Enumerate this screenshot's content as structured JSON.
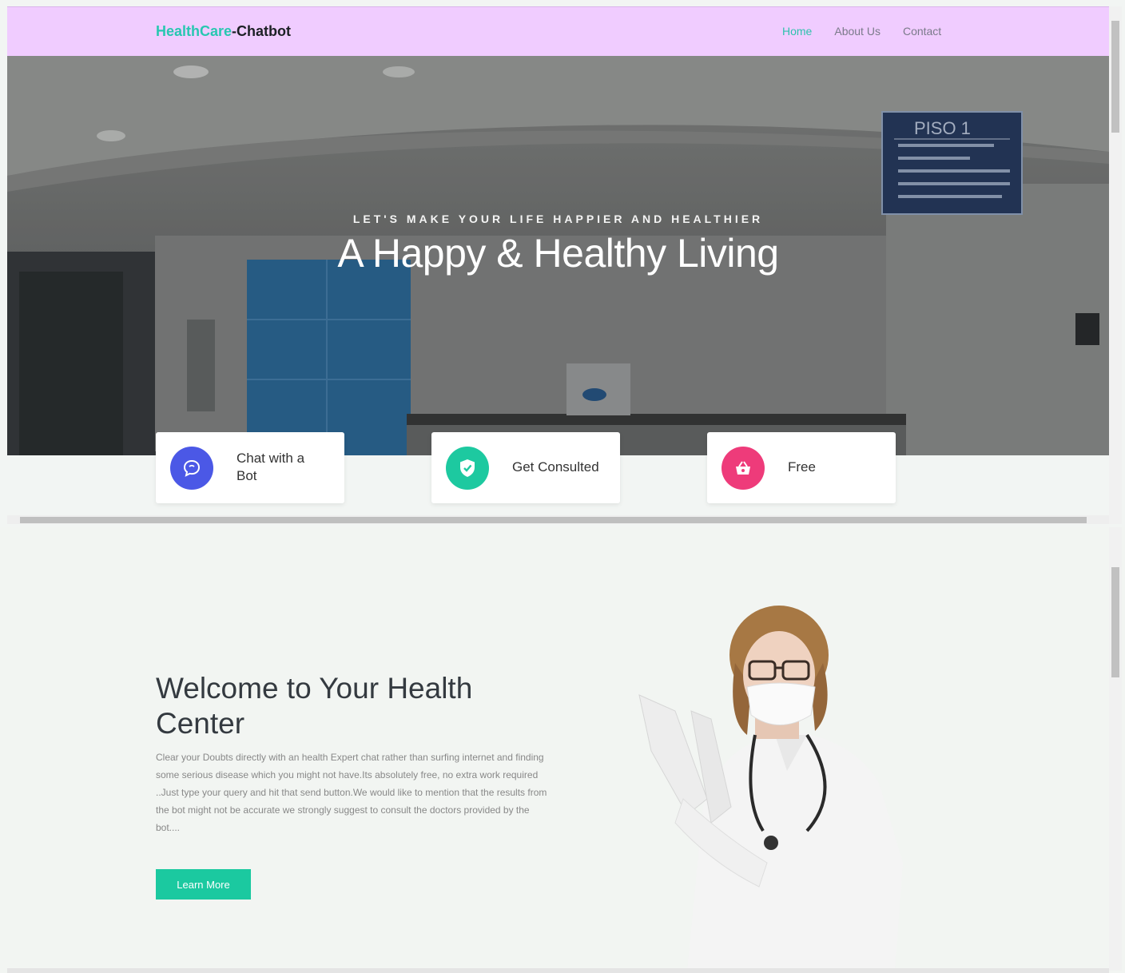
{
  "navbar": {
    "brand_accent": "HealthCare",
    "brand_main": "-Chatbot",
    "links": [
      {
        "label": "Home",
        "active": true
      },
      {
        "label": "About Us",
        "active": false
      },
      {
        "label": "Contact",
        "active": false
      }
    ]
  },
  "hero": {
    "subtitle": "LET'S MAKE YOUR LIFE HAPPIER AND HEALTHIER",
    "title": "A Happy & Healthy Living",
    "sign_title": "PISO 1"
  },
  "features": [
    {
      "label": "Chat with a Bot",
      "icon": "chat-bubble-icon",
      "color": "#4b58e6"
    },
    {
      "label": "Get Consulted",
      "icon": "shield-check-icon",
      "color": "#1dc9a0"
    },
    {
      "label": "Free",
      "icon": "basket-icon",
      "color": "#ee3b7a"
    }
  ],
  "welcome": {
    "title": "Welcome to Your Health Center",
    "text": "Clear your Doubts directly with an health Expert chat rather than surfing internet and finding some serious disease which you might not have.Its absolutely free, no extra work required ..Just type your query and hit that send button.We would like to mention that the results from the bot might not be accurate we strongly suggest to consult the doctors provided by the bot....",
    "button_label": "Learn More"
  },
  "colors": {
    "navbar_bg": "#f0ccff",
    "accent": "#28c7b1",
    "button": "#1bc9a0"
  }
}
